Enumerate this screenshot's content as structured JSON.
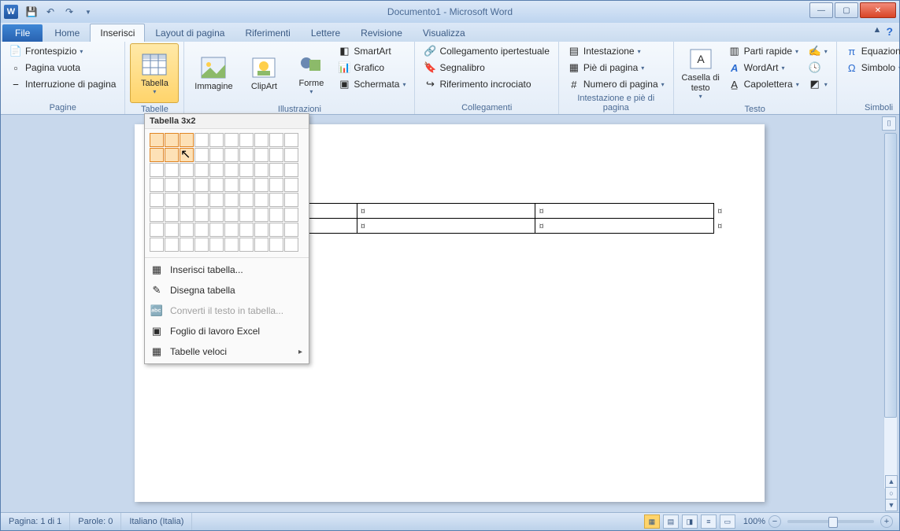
{
  "title": "Documento1 - Microsoft Word",
  "qat": {
    "word_letter": "W"
  },
  "tabs": {
    "file": "File",
    "items": [
      "Home",
      "Inserisci",
      "Layout di pagina",
      "Riferimenti",
      "Lettere",
      "Revisione",
      "Visualizza"
    ],
    "active": "Inserisci"
  },
  "ribbon": {
    "pagine": {
      "label": "Pagine",
      "frontespizio": "Frontespizio",
      "pagina_vuota": "Pagina vuota",
      "interruzione": "Interruzione di pagina"
    },
    "tabelle": {
      "label": "Tabelle",
      "tabella": "Tabella"
    },
    "illustrazioni": {
      "label": "Illustrazioni",
      "immagine": "Immagine",
      "clipart": "ClipArt",
      "forme": "Forme",
      "smartart": "SmartArt",
      "grafico": "Grafico",
      "schermata": "Schermata"
    },
    "collegamenti": {
      "label": "Collegamenti",
      "ipertestuale": "Collegamento ipertestuale",
      "segnalibro": "Segnalibro",
      "riferimento": "Riferimento incrociato"
    },
    "intestazione": {
      "label": "Intestazione e piè di pagina",
      "intestazione": "Intestazione",
      "pie": "Piè di pagina",
      "numero": "Numero di pagina"
    },
    "testo": {
      "label": "Testo",
      "casella": "Casella\ndi testo",
      "parti": "Parti rapide",
      "wordart": "WordArt",
      "capolettera": "Capolettera"
    },
    "simboli": {
      "label": "Simboli",
      "equazione": "Equazione",
      "simbolo": "Simbolo"
    }
  },
  "dropdown": {
    "title": "Tabella 3x2",
    "sel_cols": 3,
    "sel_rows": 2,
    "cols": 10,
    "rows": 8,
    "items": [
      {
        "icon": "grid",
        "label": "Inserisci tabella...",
        "disabled": false
      },
      {
        "icon": "pencil",
        "label": "Disegna tabella",
        "disabled": false
      },
      {
        "icon": "convert",
        "label": "Converti il testo in tabella...",
        "disabled": true
      },
      {
        "icon": "excel",
        "label": "Foglio di lavoro Excel",
        "disabled": false
      },
      {
        "icon": "quick",
        "label": "Tabelle veloci",
        "disabled": false,
        "submenu": true
      }
    ]
  },
  "doc": {
    "cell_mark": "¤"
  },
  "status": {
    "page": "Pagina: 1 di 1",
    "words": "Parole: 0",
    "lang": "Italiano (Italia)",
    "zoom": "100%"
  }
}
